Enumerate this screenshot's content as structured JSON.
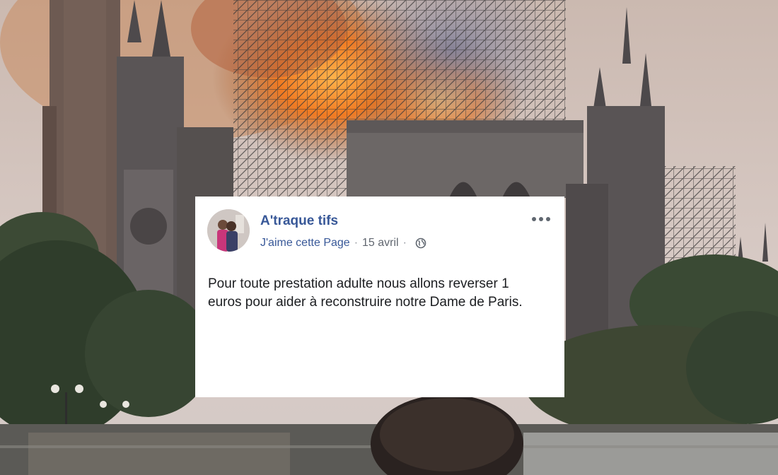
{
  "post": {
    "page_name": "A'traque tifs",
    "like_link": "J'aime cette Page",
    "separator": "·",
    "date": "15 avril",
    "text": "Pour toute prestation adulte nous allons reverser 1 euros pour aider à reconstruire notre Dame de Paris."
  },
  "icons": {
    "more": "more-horizontal-icon",
    "audience": "globe-icon"
  },
  "colors": {
    "page_name": "#385898",
    "meta_text": "#616770",
    "body_text": "#1c1e21",
    "card_background": "#ffffff",
    "fire": "#f07a22"
  }
}
